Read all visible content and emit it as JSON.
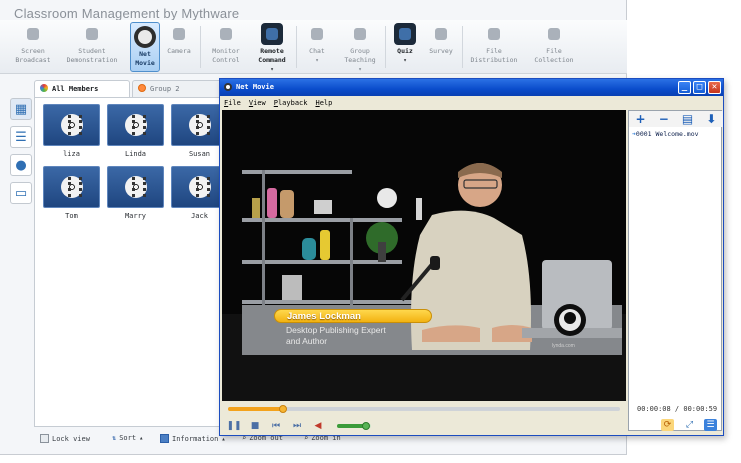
{
  "app": {
    "title": "Classroom Management by Mythware"
  },
  "toolbar": {
    "items": [
      {
        "label1": "Screen",
        "label2": "Broadcast"
      },
      {
        "label1": "Student",
        "label2": "Demonstration"
      },
      {
        "label1": "Net",
        "label2": "Movie"
      },
      {
        "label1": "Camera",
        "label2": ""
      },
      {
        "label1": "Monitor",
        "label2": "Control"
      },
      {
        "label1": "Remote",
        "label2": "Command"
      },
      {
        "label1": "Chat",
        "label2": ""
      },
      {
        "label1": "Group",
        "label2": "Teaching"
      },
      {
        "label1": "Quiz",
        "label2": ""
      },
      {
        "label1": "Survey",
        "label2": ""
      },
      {
        "label1": "File",
        "label2": "Distribution"
      },
      {
        "label1": "File",
        "label2": "Collection"
      }
    ]
  },
  "groups": {
    "all_members": "All Members",
    "group2": "Group 2"
  },
  "members": [
    "liza",
    "Linda",
    "Susan",
    "Tom",
    "Marry",
    "Jack"
  ],
  "status_bar": {
    "lock_view": "Lock view",
    "sort": "Sort",
    "information": "Information",
    "zoom_out": "Zoom out",
    "zoom_in": "Zoom in"
  },
  "net_movie": {
    "title": "Net Movie",
    "menu": [
      "File",
      "View",
      "Playback",
      "Help"
    ],
    "playlist": [
      {
        "number": "0001",
        "name": "Welcome.mov"
      }
    ],
    "time": {
      "current": "00:00:08",
      "total": "00:00:59"
    },
    "progress": 0.14,
    "volume": 0.85,
    "lower_third": {
      "name": "James Lockman",
      "line1": "Desktop Publishing Expert",
      "line2": "and Author"
    },
    "watermark": "lynda.com"
  }
}
